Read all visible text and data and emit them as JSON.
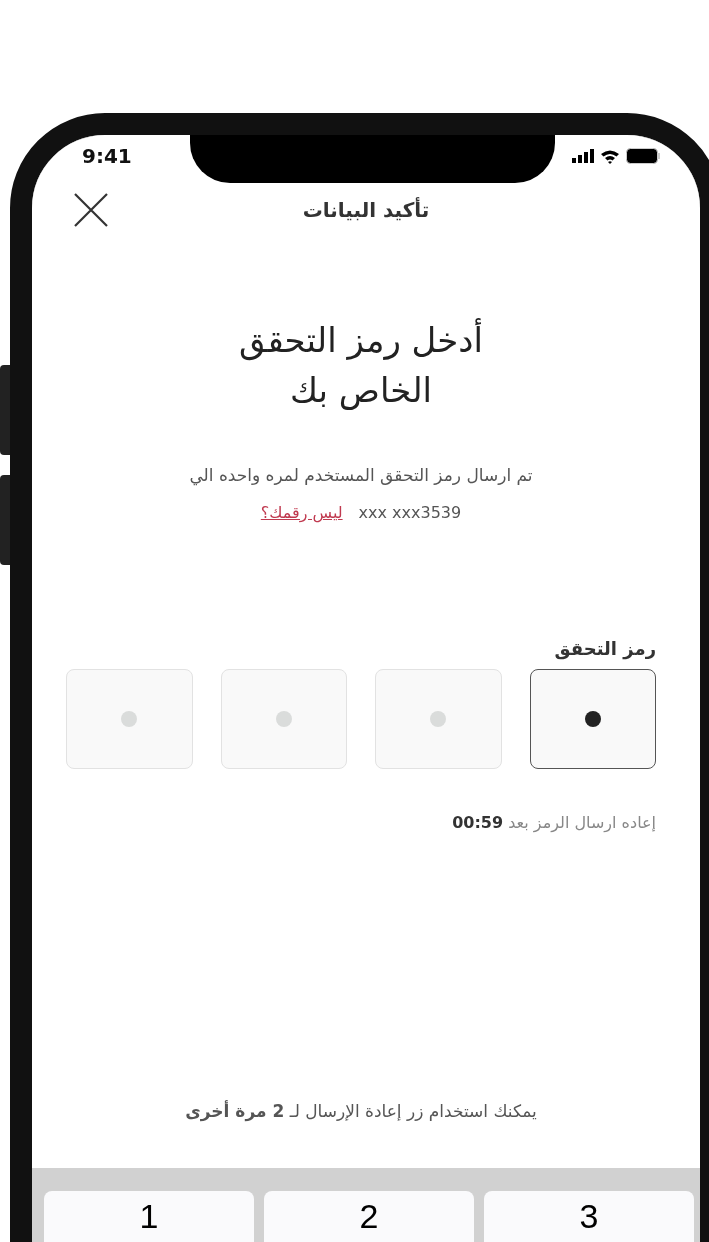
{
  "status_bar": {
    "time": "9:41"
  },
  "header": {
    "title": "تأكيد البيانات"
  },
  "heading_lines": [
    "أدخل رمز التحقق",
    "الخاص بك"
  ],
  "message": {
    "text": "تم ارسال رمز التحقق المستخدم لمره واحده الي",
    "phone": "xxx xxx3539",
    "change_link": "ليس رقمك؟"
  },
  "code": {
    "label": "رمز التحقق",
    "digits": [
      {
        "selected": true
      },
      {
        "selected": false
      },
      {
        "selected": false
      },
      {
        "selected": false
      }
    ]
  },
  "resend_timer": {
    "text": "إعاده ارسال الرمز بعد",
    "time": "00:59"
  },
  "resend_note": "يمكنك استخدام زر إعادة الإرسال لـ **2 مرة أخرى**",
  "keypad": {
    "keys": [
      "3",
      "2",
      "1"
    ]
  }
}
